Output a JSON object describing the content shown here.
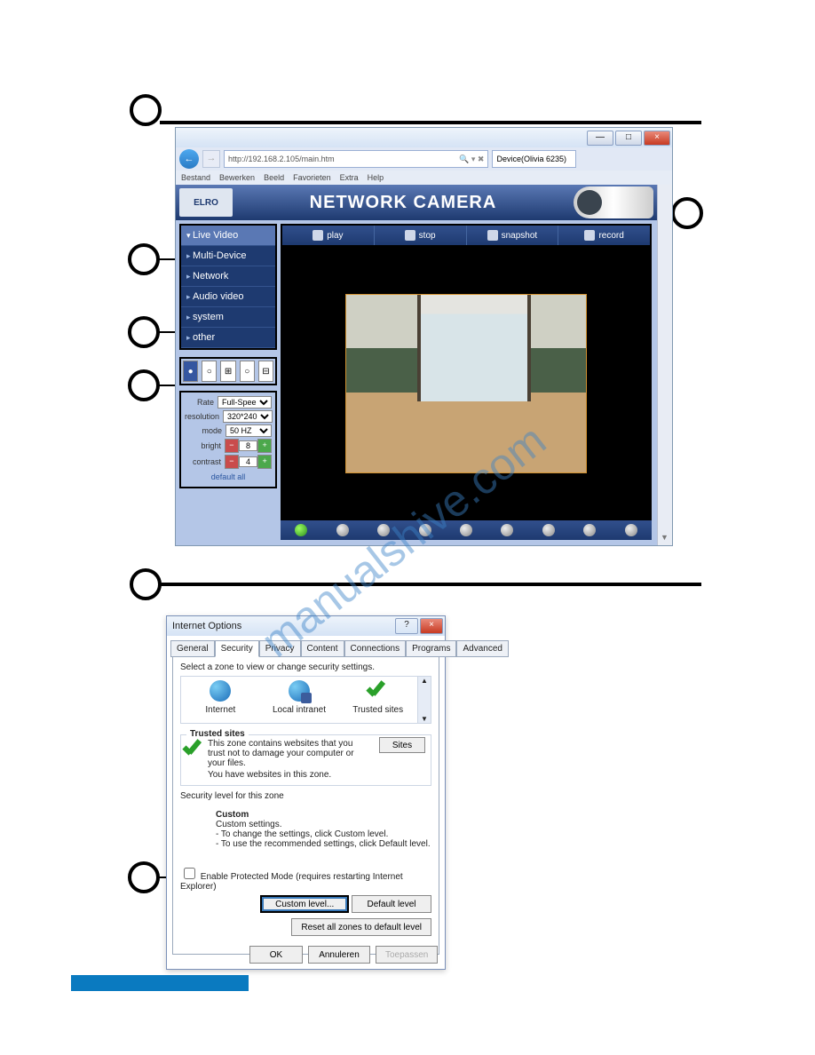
{
  "screenshot1": {
    "window_buttons": {
      "min": "—",
      "max": "□",
      "close": "×"
    },
    "url": "http://192.168.2.105/main.htm",
    "search_suffix": "🔍 ▾ ✖",
    "tab": "Device(Olivia 6235)",
    "menu": [
      "Bestand",
      "Bewerken",
      "Beeld",
      "Favorieten",
      "Extra",
      "Help"
    ],
    "logo": "ELRO",
    "title": "NETWORK CAMERA",
    "sidemenu": [
      "Live Video",
      "Multi-Device",
      "Network",
      "Audio video",
      "system",
      "other"
    ],
    "toolbar": [
      "play",
      "stop",
      "snapshot",
      "record"
    ],
    "controls": {
      "rate_label": "Rate",
      "rate_value": "Full-Spee",
      "res_label": "resolution",
      "res_value": "320*240",
      "mode_label": "mode",
      "mode_value": "50 HZ",
      "bright_label": "bright",
      "bright_value": "8",
      "contrast_label": "contrast",
      "contrast_value": "4",
      "default": "default all"
    }
  },
  "screenshot2": {
    "title": "Internet Options",
    "help": "?",
    "close": "×",
    "tabs": [
      "General",
      "Security",
      "Privacy",
      "Content",
      "Connections",
      "Programs",
      "Advanced"
    ],
    "active_tab": "Security",
    "select_zone": "Select a zone to view or change security settings.",
    "zones": [
      "Internet",
      "Local intranet",
      "Trusted sites"
    ],
    "trusted_heading": "Trusted sites",
    "trusted_desc1": "This zone contains websites that you trust not to damage your computer or your files.",
    "trusted_desc2": "You have websites in this zone.",
    "sites_btn": "Sites",
    "sec_level": "Security level for this zone",
    "custom_h": "Custom",
    "custom_l1": "Custom settings.",
    "custom_l2": "- To change the settings, click Custom level.",
    "custom_l3": "- To use the recommended settings, click Default level.",
    "epm": "Enable Protected Mode (requires restarting Internet Explorer)",
    "custom_btn": "Custom level...",
    "default_btn": "Default level",
    "reset_btn": "Reset all zones to default level",
    "ok": "OK",
    "cancel": "Annuleren",
    "apply": "Toepassen"
  },
  "watermark": "manualshive.com"
}
